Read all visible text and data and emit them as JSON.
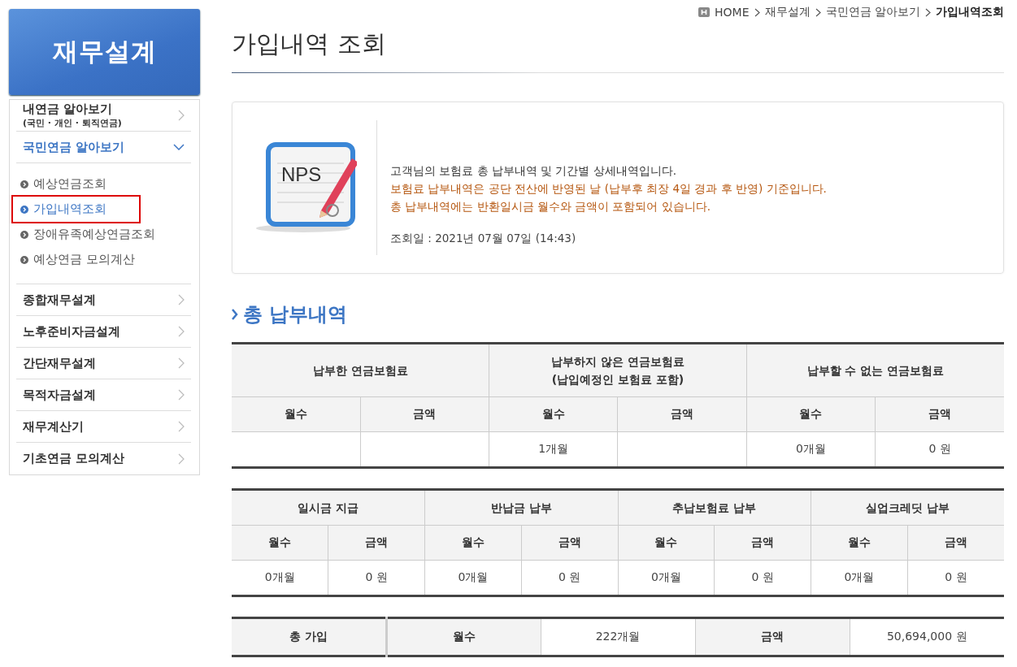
{
  "sidebar": {
    "title": "재무설계",
    "items": [
      {
        "label": "내연금 알아보기",
        "sublabel": "(국민 · 개인  · 퇴직연금)",
        "expanded": false
      },
      {
        "label": "국민연금 알아보기",
        "expanded": true,
        "children": [
          {
            "label": "예상연금조회",
            "selected": false
          },
          {
            "label": "가입내역조회",
            "selected": true
          },
          {
            "label": "장애유족예상연금조회",
            "selected": false
          },
          {
            "label": "예상연금 모의계산",
            "selected": false
          }
        ]
      },
      {
        "label": "종합재무설계",
        "expanded": false
      },
      {
        "label": "노후준비자금설계",
        "expanded": false
      },
      {
        "label": "간단재무설계",
        "expanded": false
      },
      {
        "label": "목적자금설계",
        "expanded": false
      },
      {
        "label": "재무계산기",
        "expanded": false
      },
      {
        "label": "기초연금 모의계산",
        "expanded": false
      }
    ]
  },
  "breadcrumb": [
    {
      "label": "HOME",
      "current": false
    },
    {
      "label": "재무설계",
      "current": false
    },
    {
      "label": "국민연금 알아보기",
      "current": false
    },
    {
      "label": "가입내역조회",
      "current": true
    }
  ],
  "page_title": "가입내역 조회",
  "info": {
    "logo_text": "NPS",
    "lines": [
      {
        "text": "고객님의 보험료 총 납부내역 및 기간별 상세내역입니다.",
        "kind": "normal"
      },
      {
        "text": "보험료 납부내역은 공단 전산에 반영된 날 (납부후 최장 4일 경과 후 반영) 기준입니다.",
        "kind": "notice"
      },
      {
        "text": "총 납부내역에는 반환일시금 월수와 금액이 포함되어 있습니다.",
        "kind": "notice"
      }
    ],
    "query_date": "조회일 : 2021년 07월 07일 (14:43)"
  },
  "section_title": "총 납부내역",
  "tables": [
    {
      "groups": [
        {
          "label": "납부한 연금보험료",
          "columns": [
            {
              "label": "월수"
            },
            {
              "label": "금액"
            }
          ]
        },
        {
          "label": "납부하지 않은 연금보험료\n(납입예정인 보험료 포함)",
          "columns": [
            {
              "label": "월수",
              "value": "1개월"
            },
            {
              "label": "금액"
            }
          ]
        },
        {
          "label": "납부할 수 없는 연금보험료",
          "columns": [
            {
              "label": "월수",
              "value": "0개월"
            },
            {
              "label": "금액",
              "value": "0 원"
            }
          ]
        }
      ]
    },
    {
      "groups": [
        {
          "label": "일시금 지급",
          "columns": [
            {
              "label": "월수",
              "value": "0개월"
            },
            {
              "label": "금액",
              "value": "0 원"
            }
          ]
        },
        {
          "label": "반납금 납부",
          "columns": [
            {
              "label": "월수",
              "value": "0개월"
            },
            {
              "label": "금액",
              "value": "0 원"
            }
          ]
        },
        {
          "label": "추납보험료 납부",
          "columns": [
            {
              "label": "월수",
              "value": "0개월"
            },
            {
              "label": "금액",
              "value": "0 원"
            }
          ]
        },
        {
          "label": "실업크레딧 납부",
          "columns": [
            {
              "label": "월수",
              "value": "0개월"
            },
            {
              "label": "금액",
              "value": "0 원"
            }
          ]
        }
      ]
    }
  ],
  "total": [
    {
      "text": "총 가입",
      "kind": "header"
    },
    {
      "text": "월수",
      "kind": "label"
    },
    {
      "text": "222개월",
      "kind": "value"
    },
    {
      "text": "금액",
      "kind": "label"
    },
    {
      "text": "50,694,000 원",
      "kind": "value"
    }
  ]
}
